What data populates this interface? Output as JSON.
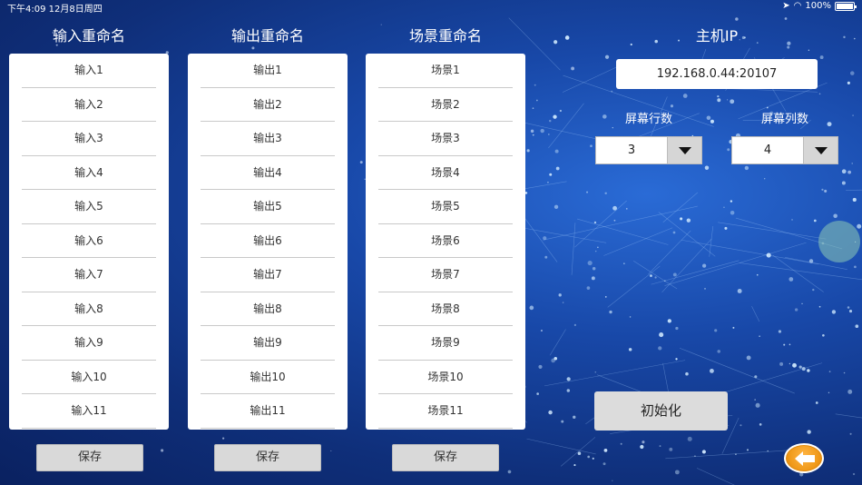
{
  "status_bar": {
    "time_date": "下午4:09   12月8日周四",
    "battery": "100%"
  },
  "columns": [
    {
      "title": "输入重命名",
      "items": [
        "输入1",
        "输入2",
        "输入3",
        "输入4",
        "输入5",
        "输入6",
        "输入7",
        "输入8",
        "输入9",
        "输入10",
        "输入11"
      ],
      "save_label": "保存"
    },
    {
      "title": "输出重命名",
      "items": [
        "输出1",
        "输出2",
        "输出3",
        "输出4",
        "输出5",
        "输出6",
        "输出7",
        "输出8",
        "输出9",
        "输出10",
        "输出11"
      ],
      "save_label": "保存"
    },
    {
      "title": "场景重命名",
      "items": [
        "场景1",
        "场景2",
        "场景3",
        "场景4",
        "场景5",
        "场景6",
        "场景7",
        "场景8",
        "场景9",
        "场景10",
        "场景11"
      ],
      "save_label": "保存"
    }
  ],
  "host": {
    "title": "主机IP",
    "ip": "192.168.0.44:20107"
  },
  "screen_rows": {
    "label": "屏幕行数",
    "value": "3"
  },
  "screen_cols": {
    "label": "屏幕列数",
    "value": "4"
  },
  "init_label": "初始化",
  "icons": {
    "back": "back-arrow-icon",
    "wifi": "wifi-icon",
    "location": "location-icon",
    "battery": "battery-icon"
  },
  "colors": {
    "accent": "#f09a1a",
    "background": "#1848a8"
  }
}
